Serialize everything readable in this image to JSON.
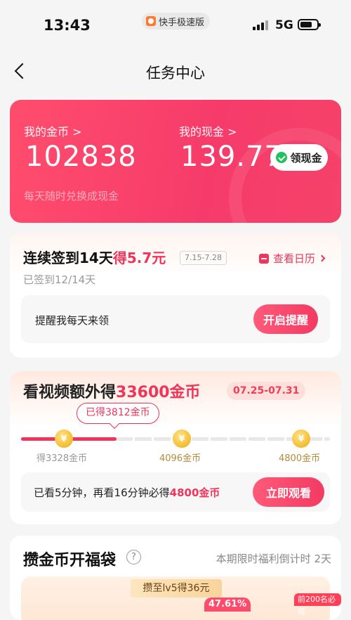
{
  "status_bar": {
    "time": "13:43",
    "app_name": "快手极速版",
    "network": "5G"
  },
  "nav": {
    "title": "任务中心"
  },
  "wallet": {
    "coins_label": "我的金币 >",
    "coins_value": "102838",
    "cash_label": "我的现金 >",
    "cash_value": "139.77",
    "withdraw_label": "领现金",
    "subtitle": "每天随时兑换成现金"
  },
  "signin": {
    "title_main": "连续签到14天",
    "title_reward": "得5.7元",
    "date_range": "7.15-7.28",
    "calendar_link": "查看日历",
    "progress_text": "已签到12/14天",
    "remind_text": "提醒我每天来领",
    "remind_button": "开启提醒"
  },
  "video_task": {
    "title_main": "看视频额外得",
    "title_reward": "33600金币",
    "date_range": "07.25-07.31",
    "earned_label": "已得3812金币",
    "progress_fraction": 0.31,
    "milestones": [
      {
        "label": "得3328金币",
        "coin_icon": "¥"
      },
      {
        "label": "4096金币",
        "coin_icon": "¥"
      },
      {
        "label": "4800金币",
        "coin_icon": "¥"
      }
    ],
    "watch_text_prefix": "已看5分钟，再看16分钟必得",
    "watch_text_reward": "4800金币",
    "watch_button": "立即观看"
  },
  "lucky_bag": {
    "title": "攒金币开福袋",
    "help_icon": "?",
    "countdown": "本期限时福利倒计时 2天",
    "level_tag": "攒至lv5得36元",
    "percent": "47.61%",
    "first_tag": "前200名必得"
  },
  "colors": {
    "accent": "#f0345a",
    "card_red": "#f63b6a"
  }
}
